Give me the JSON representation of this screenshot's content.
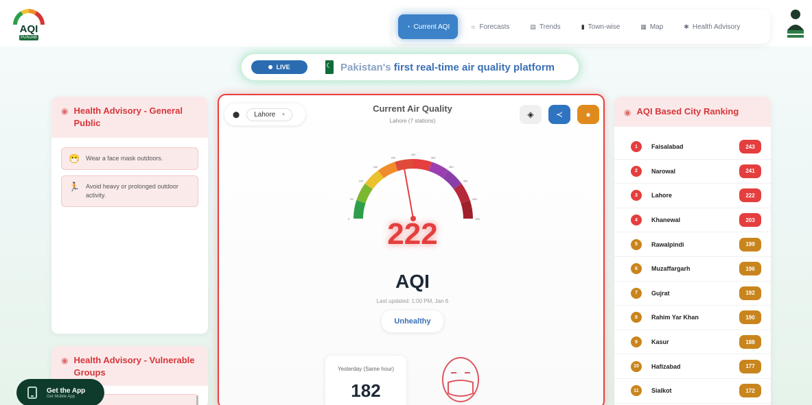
{
  "header": {
    "logo": {
      "text": "AQI",
      "sub": "PUNJAB"
    },
    "nav": [
      {
        "label": "Current AQI",
        "icon": "gauge-icon",
        "active": true
      },
      {
        "label": "Forecasts",
        "icon": "forecast-icon",
        "active": false
      },
      {
        "label": "Trends",
        "icon": "trends-icon",
        "active": false
      },
      {
        "label": "Town-wise",
        "icon": "bar-chart-icon",
        "active": false
      },
      {
        "label": "Map",
        "icon": "map-icon",
        "active": false
      },
      {
        "label": "Health Advisory",
        "icon": "health-icon",
        "active": false
      }
    ]
  },
  "banner": {
    "live": "LIVE",
    "text_prefix": "Pakistan's",
    "text_rest": " first real-time air quality platform"
  },
  "advisory_general": {
    "title": "Health Advisory - General Public",
    "items": [
      {
        "icon": "mask-icon",
        "text": "Wear a face mask outdoors."
      },
      {
        "icon": "no-activity-icon",
        "text": "Avoid heavy or prolonged outdoor activity."
      }
    ]
  },
  "advisory_vulnerable": {
    "title": "Health Advisory - Vulnerable Groups"
  },
  "current": {
    "city": "Lahore",
    "title": "Current Air Quality",
    "subtitle": "Lahore (7 stations)",
    "aqi": "222",
    "aqi_label": "AQI",
    "updated": "Last updated: 1:00 PM, Jan 6",
    "status": "Unhealthy",
    "yesterday_label": "Yesterday (Same hour)",
    "yesterday_value": "182",
    "gauge_value": 222,
    "gauge_ticks": [
      "0",
      "50",
      "100",
      "150",
      "200",
      "250",
      "300",
      "350",
      "400",
      "450",
      "500"
    ]
  },
  "ranking": {
    "title": "AQI Based City Ranking",
    "rows": [
      {
        "rank": "1",
        "city": "Faisalabad",
        "aqi": "243",
        "color": "#e53e3e"
      },
      {
        "rank": "2",
        "city": "Narowal",
        "aqi": "241",
        "color": "#e53e3e"
      },
      {
        "rank": "3",
        "city": "Lahore",
        "aqi": "222",
        "color": "#e53e3e"
      },
      {
        "rank": "4",
        "city": "Khanewal",
        "aqi": "203",
        "color": "#e53e3e"
      },
      {
        "rank": "5",
        "city": "Rawalpindi",
        "aqi": "199",
        "color": "#c9851d"
      },
      {
        "rank": "6",
        "city": "Muzaffargarh",
        "aqi": "196",
        "color": "#c9851d"
      },
      {
        "rank": "7",
        "city": "Gujrat",
        "aqi": "192",
        "color": "#c9851d"
      },
      {
        "rank": "8",
        "city": "Rahim Yar Khan",
        "aqi": "190",
        "color": "#c9851d"
      },
      {
        "rank": "9",
        "city": "Kasur",
        "aqi": "188",
        "color": "#c9851d"
      },
      {
        "rank": "10",
        "city": "Hafizabad",
        "aqi": "177",
        "color": "#c9851d"
      },
      {
        "rank": "11",
        "city": "Sialkot",
        "aqi": "172",
        "color": "#c9851d"
      }
    ]
  },
  "get_app": {
    "title": "Get the App",
    "sub": "Get Mobile App"
  }
}
